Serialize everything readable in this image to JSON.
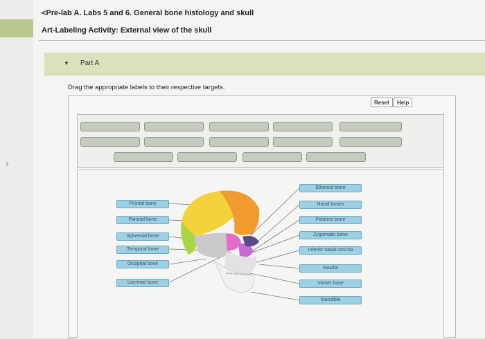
{
  "breadcrumb": "<Pre-lab A. Labs 5 and 6. General bone histology and skull",
  "title": "Art-Labeling Activity: External view of the skull",
  "part": {
    "label": "Part A"
  },
  "instructions": "Drag the appropriate labels to their respective targets.",
  "toolbar": {
    "reset_label": "Reset",
    "help_label": "Help"
  },
  "left_labels": [
    "Frontal bone",
    "Parietal bone",
    "Sphenoid bone",
    "Temporal bone",
    "Occipital bone",
    "Lacrimal bone"
  ],
  "right_labels": [
    "Ethmoid bone",
    "Nasal bones",
    "Palatine bone",
    "Zygomatic bone",
    "Inferior nasal concha",
    "Maxilla",
    "Vomer bone",
    "Mandible"
  ]
}
